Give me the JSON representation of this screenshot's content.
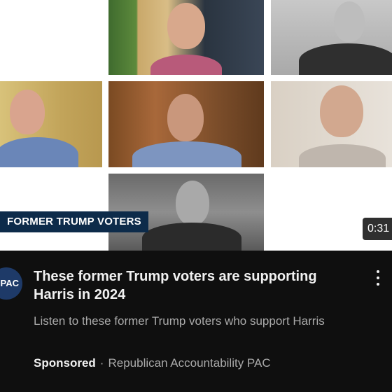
{
  "video": {
    "banner_text": "FORMER TRUMP VOTERS",
    "duration": "0:31"
  },
  "channel": {
    "avatar_text": "PAC",
    "accent_color": "#1e3a68"
  },
  "ad": {
    "title": "These former Trump voters are supporting Harris in 2024",
    "description": "Listen to these former Trump voters who support Harris",
    "sponsored_label": "Sponsored",
    "separator": "·",
    "advertiser": "Republican Accountability PAC"
  },
  "icons": {
    "more": "more-vert-icon"
  }
}
